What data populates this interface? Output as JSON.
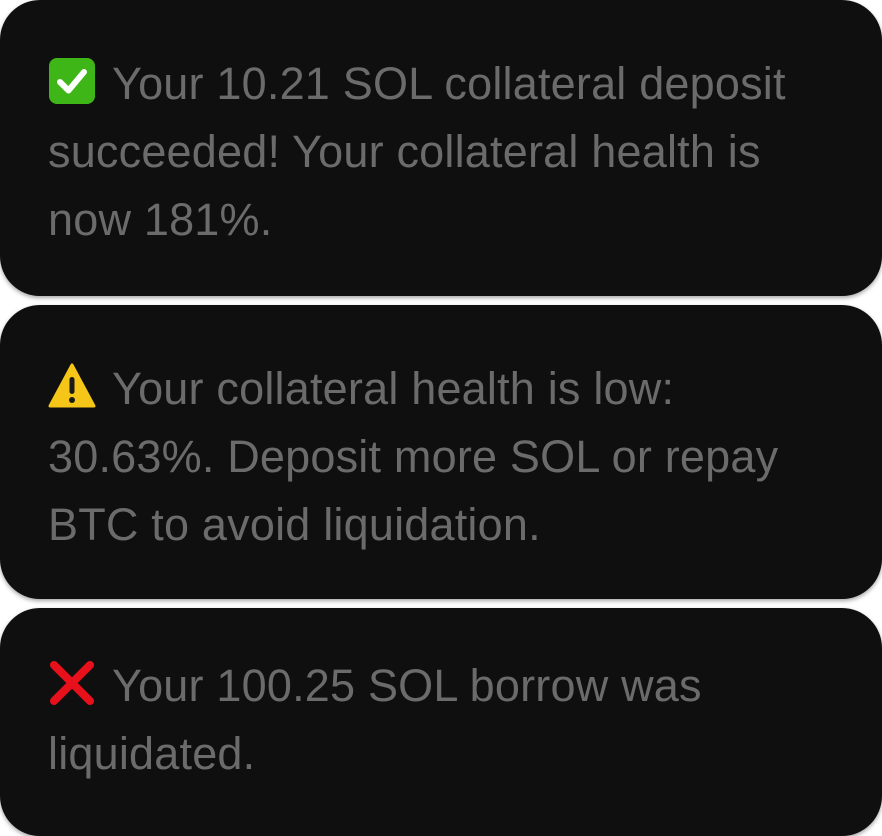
{
  "notifications": [
    {
      "type": "success",
      "icon": "check-mark-button-icon",
      "text": "Your 10.21 SOL collateral deposit succeeded! Your collateral health is now 181%."
    },
    {
      "type": "warning",
      "icon": "warning-sign-icon",
      "text": "Your collateral health is low: 30.63%. Deposit more SOL or repay BTC to avoid liquidation."
    },
    {
      "type": "error",
      "icon": "cross-mark-icon",
      "text": "Your 100.25 SOL borrow was liquidated."
    }
  ],
  "colors": {
    "toast_background": "#0f0f0f",
    "text": "#6b6b6b",
    "success": "#3fb618",
    "warning": "#f5c518",
    "error": "#e8101a"
  }
}
